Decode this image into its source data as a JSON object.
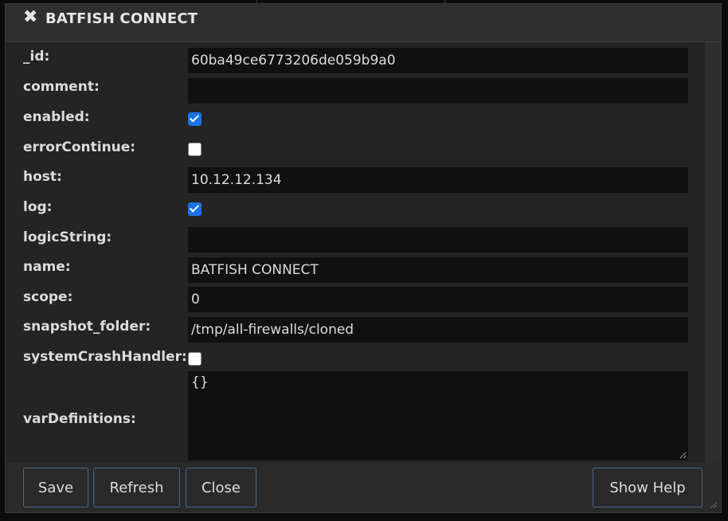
{
  "window": {
    "title": "BATFISH CONNECT",
    "close_icon": "close-x-icon"
  },
  "fields": {
    "id": {
      "label": "_id:",
      "value": "60ba49ce6773206de059b9a0"
    },
    "comment": {
      "label": "comment:",
      "value": ""
    },
    "enabled": {
      "label": "enabled:",
      "checked": true
    },
    "errorContinue": {
      "label": "errorContinue:",
      "checked": false
    },
    "host": {
      "label": "host:",
      "value": "10.12.12.134"
    },
    "log": {
      "label": "log:",
      "checked": true
    },
    "logicString": {
      "label": "logicString:",
      "value": ""
    },
    "name": {
      "label": "name:",
      "value": "BATFISH CONNECT"
    },
    "scope": {
      "label": "scope:",
      "value": "0"
    },
    "snapshot_folder": {
      "label": "snapshot_folder:",
      "value": "/tmp/all-firewalls/cloned"
    },
    "systemCrashHandler": {
      "label": "systemCrashHandler:",
      "checked": false
    },
    "varDefinitions": {
      "label": "varDefinitions:",
      "value": "{}"
    }
  },
  "buttons": {
    "save": "Save",
    "refresh": "Refresh",
    "close": "Close",
    "show_help": "Show Help"
  },
  "colors": {
    "accent": "#1a73e8",
    "button_border": "#4a6a8a"
  }
}
